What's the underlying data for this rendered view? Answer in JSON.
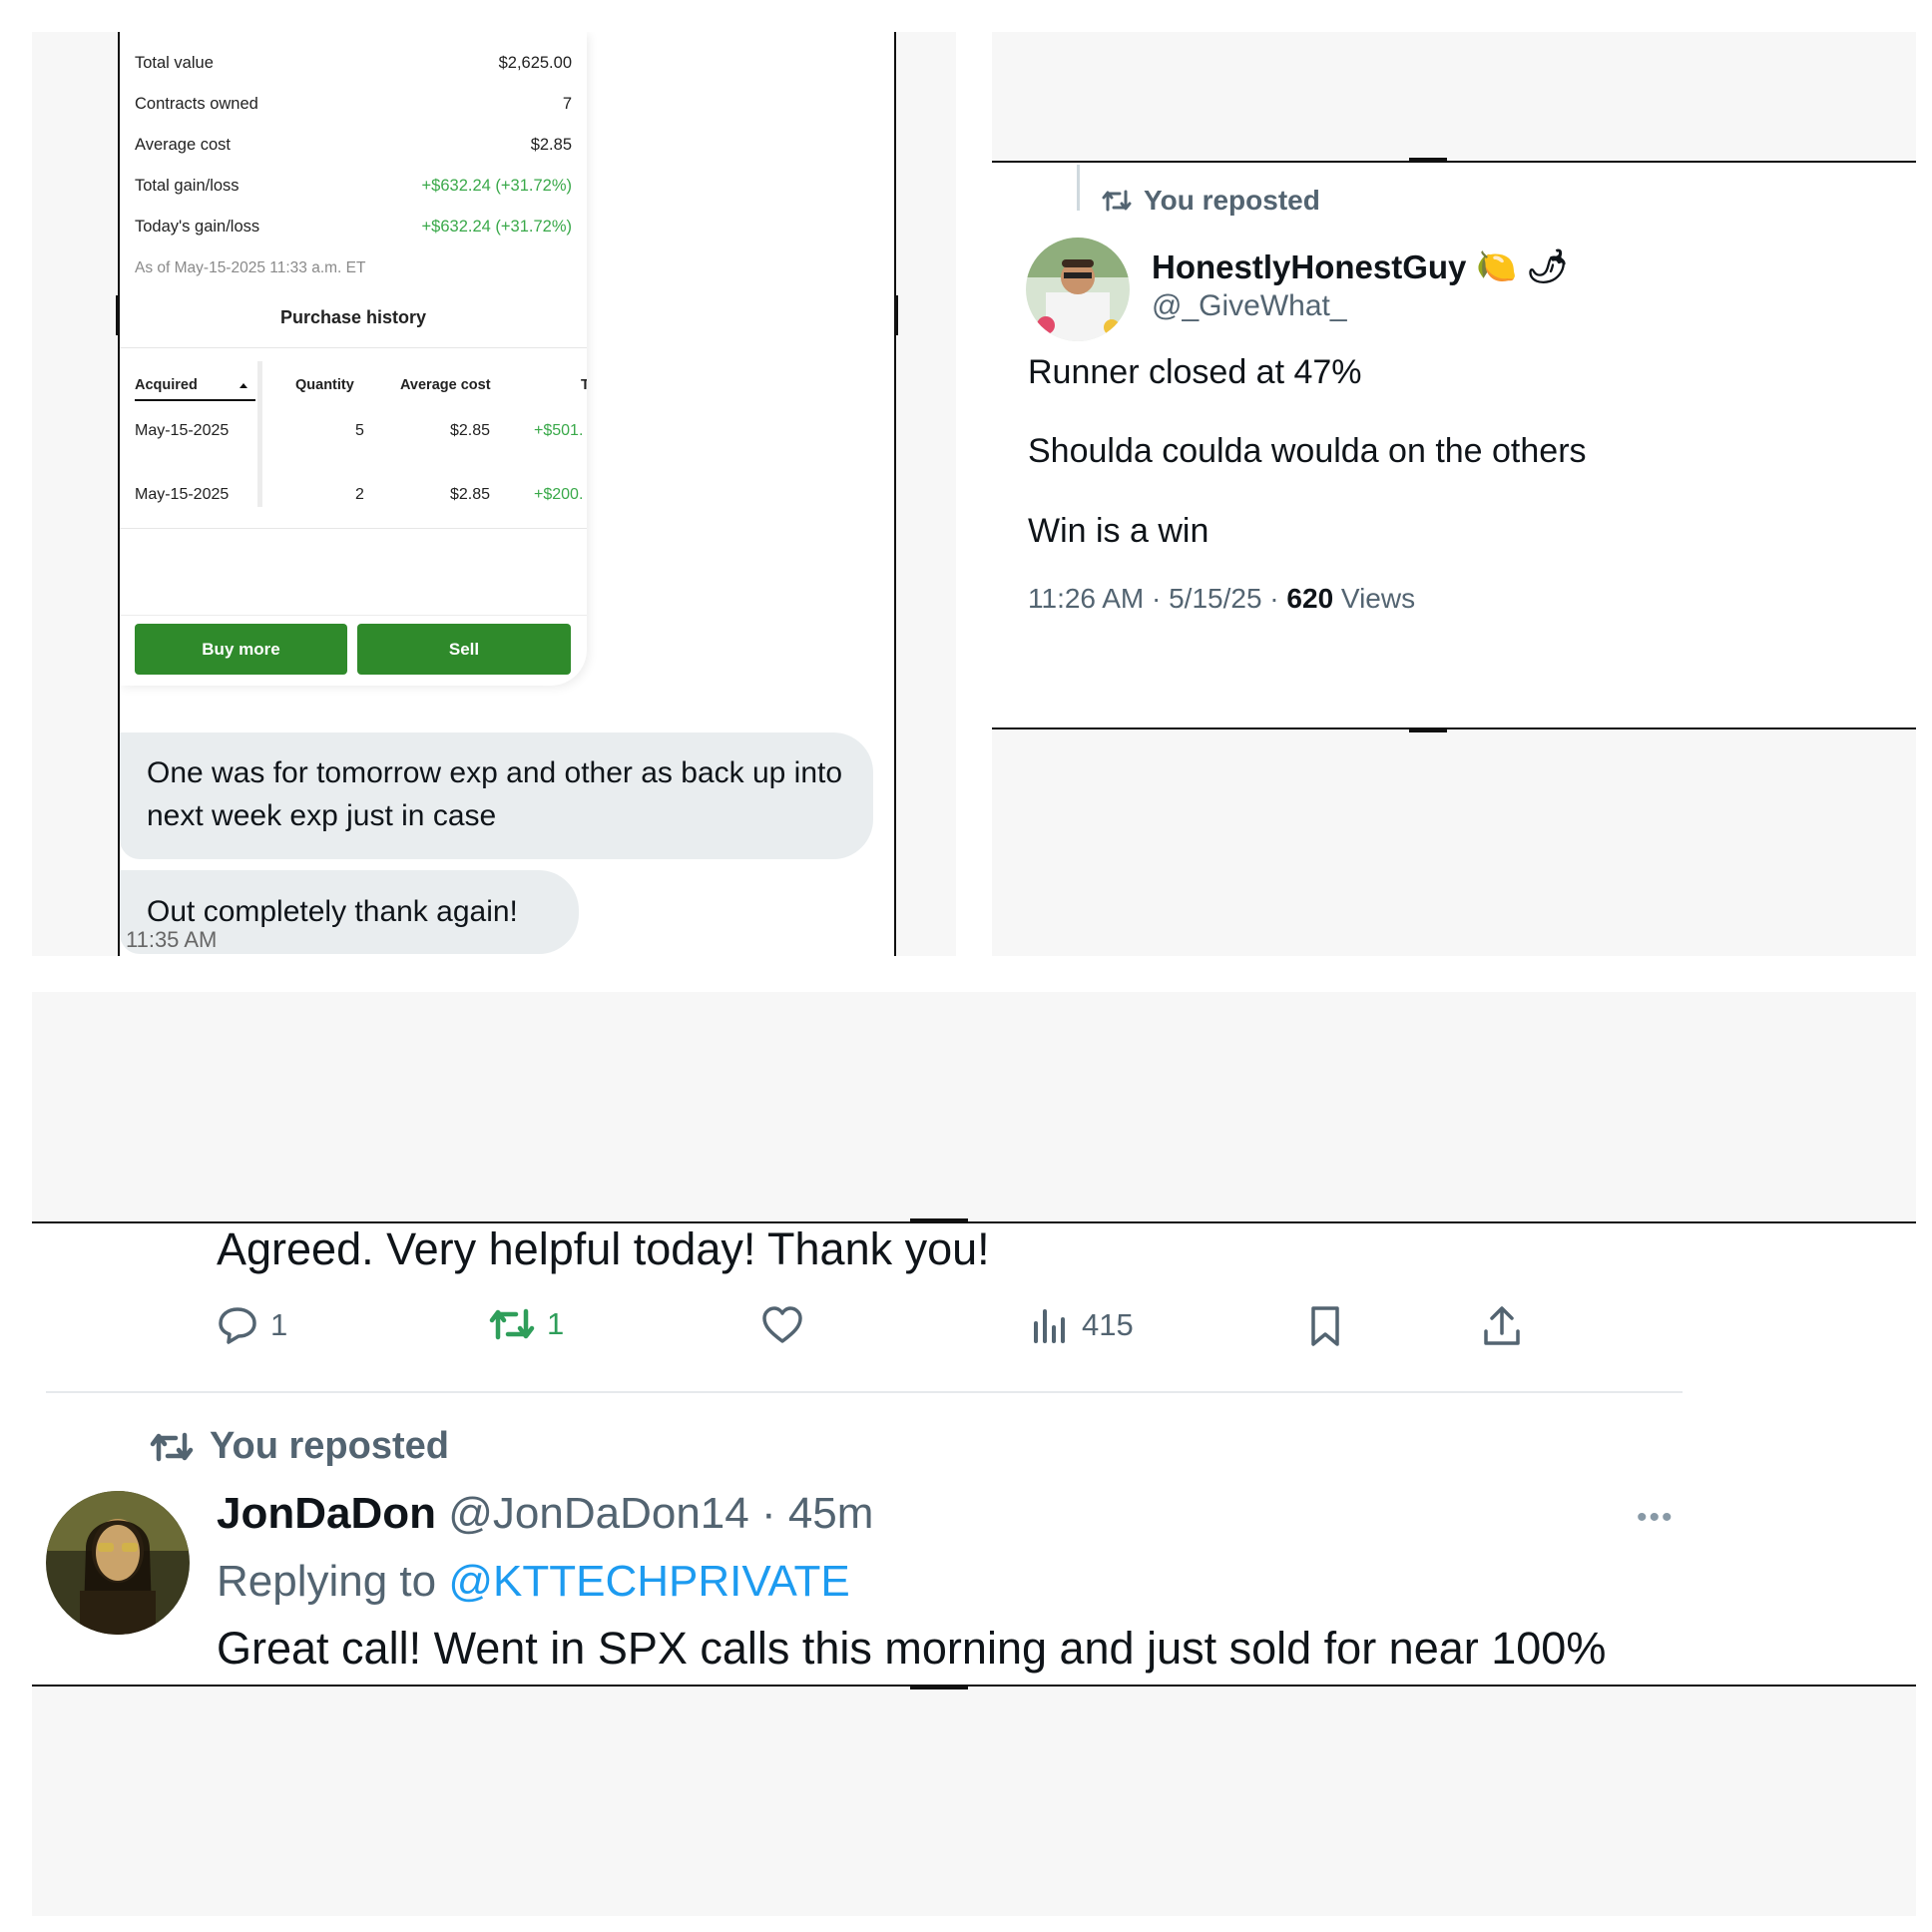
{
  "position": {
    "rows": [
      {
        "label": "Total value",
        "value": "$2,625.00",
        "green": false
      },
      {
        "label": "Contracts owned",
        "value": "7",
        "green": false
      },
      {
        "label": "Average cost",
        "value": "$2.85",
        "green": false
      },
      {
        "label": "Total gain/loss",
        "value": "+$632.24 (+31.72%)",
        "green": true
      },
      {
        "label": "Today's gain/loss",
        "value": "+$632.24 (+31.72%)",
        "green": true
      }
    ],
    "as_of": "As of May-15-2025 11:33 a.m. ET"
  },
  "purchase_history": {
    "title": "Purchase history",
    "columns": [
      "Acquired",
      "Quantity",
      "Average cost",
      "T"
    ],
    "rows": [
      {
        "acquired": "May-15-2025",
        "quantity": "5",
        "avg_cost": "$2.85",
        "gain": "+$501."
      },
      {
        "acquired": "May-15-2025",
        "quantity": "2",
        "avg_cost": "$2.85",
        "gain": "+$200."
      }
    ],
    "buy_label": "Buy more",
    "sell_label": "Sell"
  },
  "messages": {
    "bubble1": "One was for tomorrow exp and other as back up into next week exp just in case",
    "bubble2": "Out completely thank again!",
    "time": "11:35 AM"
  },
  "tweet": {
    "repost_label": "You reposted",
    "name": "HonestlyHonestGuy",
    "name_emojis": "🍋 🌶",
    "handle": "@_GiveWhat_",
    "lines": [
      "Runner closed at 47%",
      "Shoulda coulda woulda on the others",
      "Win is a win"
    ],
    "meta_prefix": "11:26 AM · 5/15/25 · ",
    "views_count": "620",
    "views_label": " Views"
  },
  "replies": {
    "first_text": "Agreed. Very helpful today! Thank you!",
    "actions": {
      "replies": "1",
      "reposts": "1",
      "likes": "",
      "views": "415"
    },
    "repost_label": "You reposted",
    "author_name": "JonDaDon",
    "author_handle": " @JonDaDon14 · 45m",
    "replying_prefix": "Replying to ",
    "replying_mention": "@KTTECHPRIVATE",
    "second_text": "Great call! Went in SPX calls this morning and just sold for near 100%"
  },
  "colors": {
    "green_button": "#2f8a2b",
    "gain_green": "#3aa94a",
    "link_blue": "#1d9bf0",
    "repost_green": "#2f9e5a"
  }
}
